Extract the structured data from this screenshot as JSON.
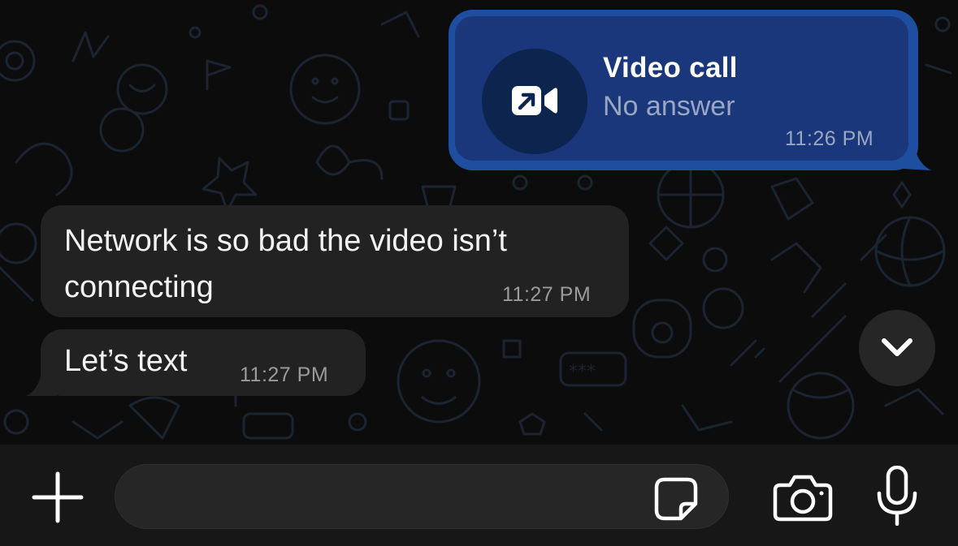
{
  "chat": {
    "call_message": {
      "icon": "video-call-outgoing-icon",
      "title": "Video call",
      "status": "No answer",
      "time": "11:26 PM"
    },
    "messages": [
      {
        "text": "Network is so bad the video isn’t connecting",
        "time": "11:27 PM"
      },
      {
        "text": "Let’s text",
        "time": "11:27 PM"
      }
    ]
  },
  "scroll_down": {
    "icon": "chevron-down-icon"
  },
  "composer": {
    "placeholder": "",
    "value": "",
    "icons": [
      "plus-icon",
      "sticker-icon",
      "camera-icon",
      "microphone-icon"
    ]
  },
  "colors": {
    "background": "#0c0c0c",
    "outgoing_bubble": "#1d4ea0",
    "outgoing_inner": "#19377a",
    "incoming_bubble": "#222222",
    "input_bar": "#171717"
  }
}
